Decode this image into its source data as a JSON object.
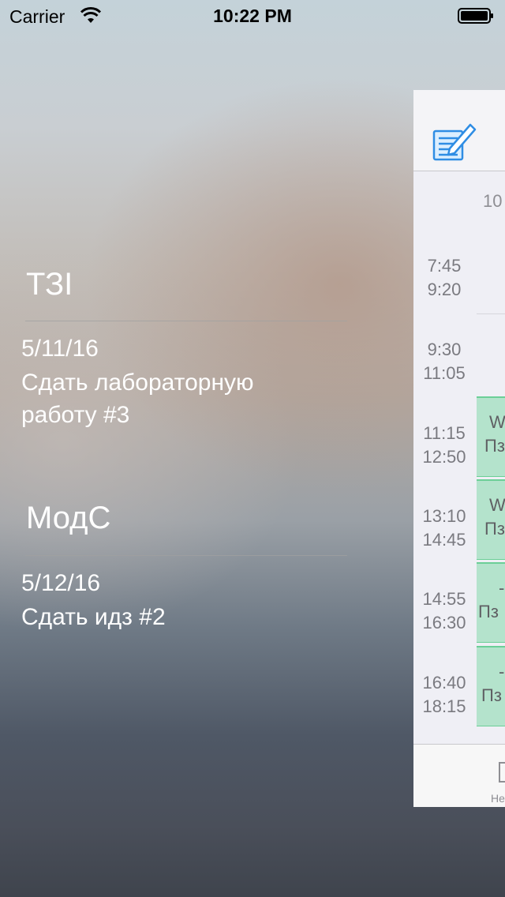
{
  "status_bar": {
    "carrier": "Carrier",
    "time": "10:22 PM"
  },
  "notes": [
    {
      "subject": "ТЗІ",
      "date": "5/11/16",
      "text": "Сдать лабораторную работу #3"
    },
    {
      "subject": "МодС",
      "date": "5/12/16",
      "text": "Сдать идз #2"
    }
  ],
  "schedule": {
    "compose_icon": "compose-icon",
    "date_label": "10",
    "slots": [
      {
        "start": "7:45",
        "end": "9:20",
        "lesson": null
      },
      {
        "start": "9:30",
        "end": "11:05",
        "lesson": null
      },
      {
        "start": "11:15",
        "end": "12:50",
        "lesson": {
          "line1": "W",
          "line2": "Пз"
        }
      },
      {
        "start": "13:10",
        "end": "14:45",
        "lesson": {
          "line1": "W",
          "line2": "Пз"
        }
      },
      {
        "start": "14:55",
        "end": "16:30",
        "lesson": {
          "line1": "-",
          "line2": "Пз"
        }
      },
      {
        "start": "16:40",
        "end": "18:15",
        "lesson": {
          "line1": "-",
          "line2": "Пз"
        }
      }
    ],
    "tab_label": "Не"
  },
  "colors": {
    "lesson_fill": "#b4e3cc",
    "lesson_border": "#6ccf97",
    "accent": "#2f8de4"
  }
}
